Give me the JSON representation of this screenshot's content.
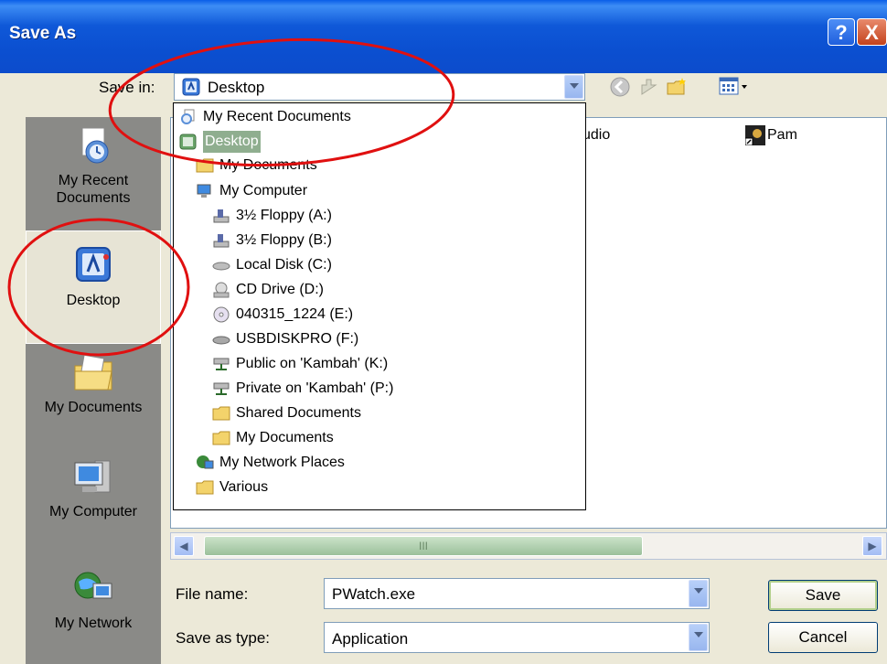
{
  "window": {
    "title": "Save As",
    "help_glyph": "?",
    "close_glyph": "X"
  },
  "save_in": {
    "label": "Save in:",
    "value": "Desktop"
  },
  "places": [
    {
      "label": "My Recent\nDocuments",
      "icon": "recent-documents-icon"
    },
    {
      "label": "Desktop",
      "icon": "desktop-icon",
      "selected": true
    },
    {
      "label": "My Documents",
      "icon": "my-documents-icon"
    },
    {
      "label": "My Computer",
      "icon": "my-computer-icon"
    },
    {
      "label": "My Network",
      "icon": "network-icon"
    }
  ],
  "background_files": {
    "item_1": "udio",
    "item_2": "Pam"
  },
  "dropdown": {
    "items": [
      {
        "label": "My Recent Documents",
        "icon": "recent-documents-icon"
      },
      {
        "label": "Desktop",
        "icon": "desktop-icon",
        "selected": true
      },
      {
        "label": "My Documents",
        "icon": "folder-icon"
      },
      {
        "label": "My Computer",
        "icon": "computer-icon"
      },
      {
        "label": "3½ Floppy (A:)",
        "icon": "floppy-icon"
      },
      {
        "label": "3½ Floppy (B:)",
        "icon": "floppy-icon"
      },
      {
        "label": "Local Disk (C:)",
        "icon": "hard-disk-icon"
      },
      {
        "label": "CD Drive (D:)",
        "icon": "cd-drive-icon"
      },
      {
        "label": "040315_1224 (E:)",
        "icon": "cd-disc-icon"
      },
      {
        "label": "USBDISKPRO (F:)",
        "icon": "usb-disk-icon"
      },
      {
        "label": "Public on 'Kambah' (K:)",
        "icon": "network-drive-icon"
      },
      {
        "label": "Private on 'Kambah' (P:)",
        "icon": "network-drive-icon"
      },
      {
        "label": "Shared Documents",
        "icon": "folder-icon"
      },
      {
        "label": "My Documents",
        "icon": "folder-icon"
      },
      {
        "label": "My Network Places",
        "icon": "network-places-icon"
      },
      {
        "label": "Various",
        "icon": "folder-icon"
      }
    ]
  },
  "scrollbar": {
    "left_glyph": "◀",
    "right_glyph": "▶",
    "thumb_glyph": "III"
  },
  "file_name": {
    "label": "File name:",
    "value": "PWatch.exe"
  },
  "save_as_type": {
    "label": "Save as type:",
    "value": "Application"
  },
  "buttons": {
    "save": "Save",
    "cancel": "Cancel"
  },
  "colors": {
    "title_bar": "#0b4fd0",
    "annotation": "#e01010",
    "selection": "#316ac5"
  }
}
